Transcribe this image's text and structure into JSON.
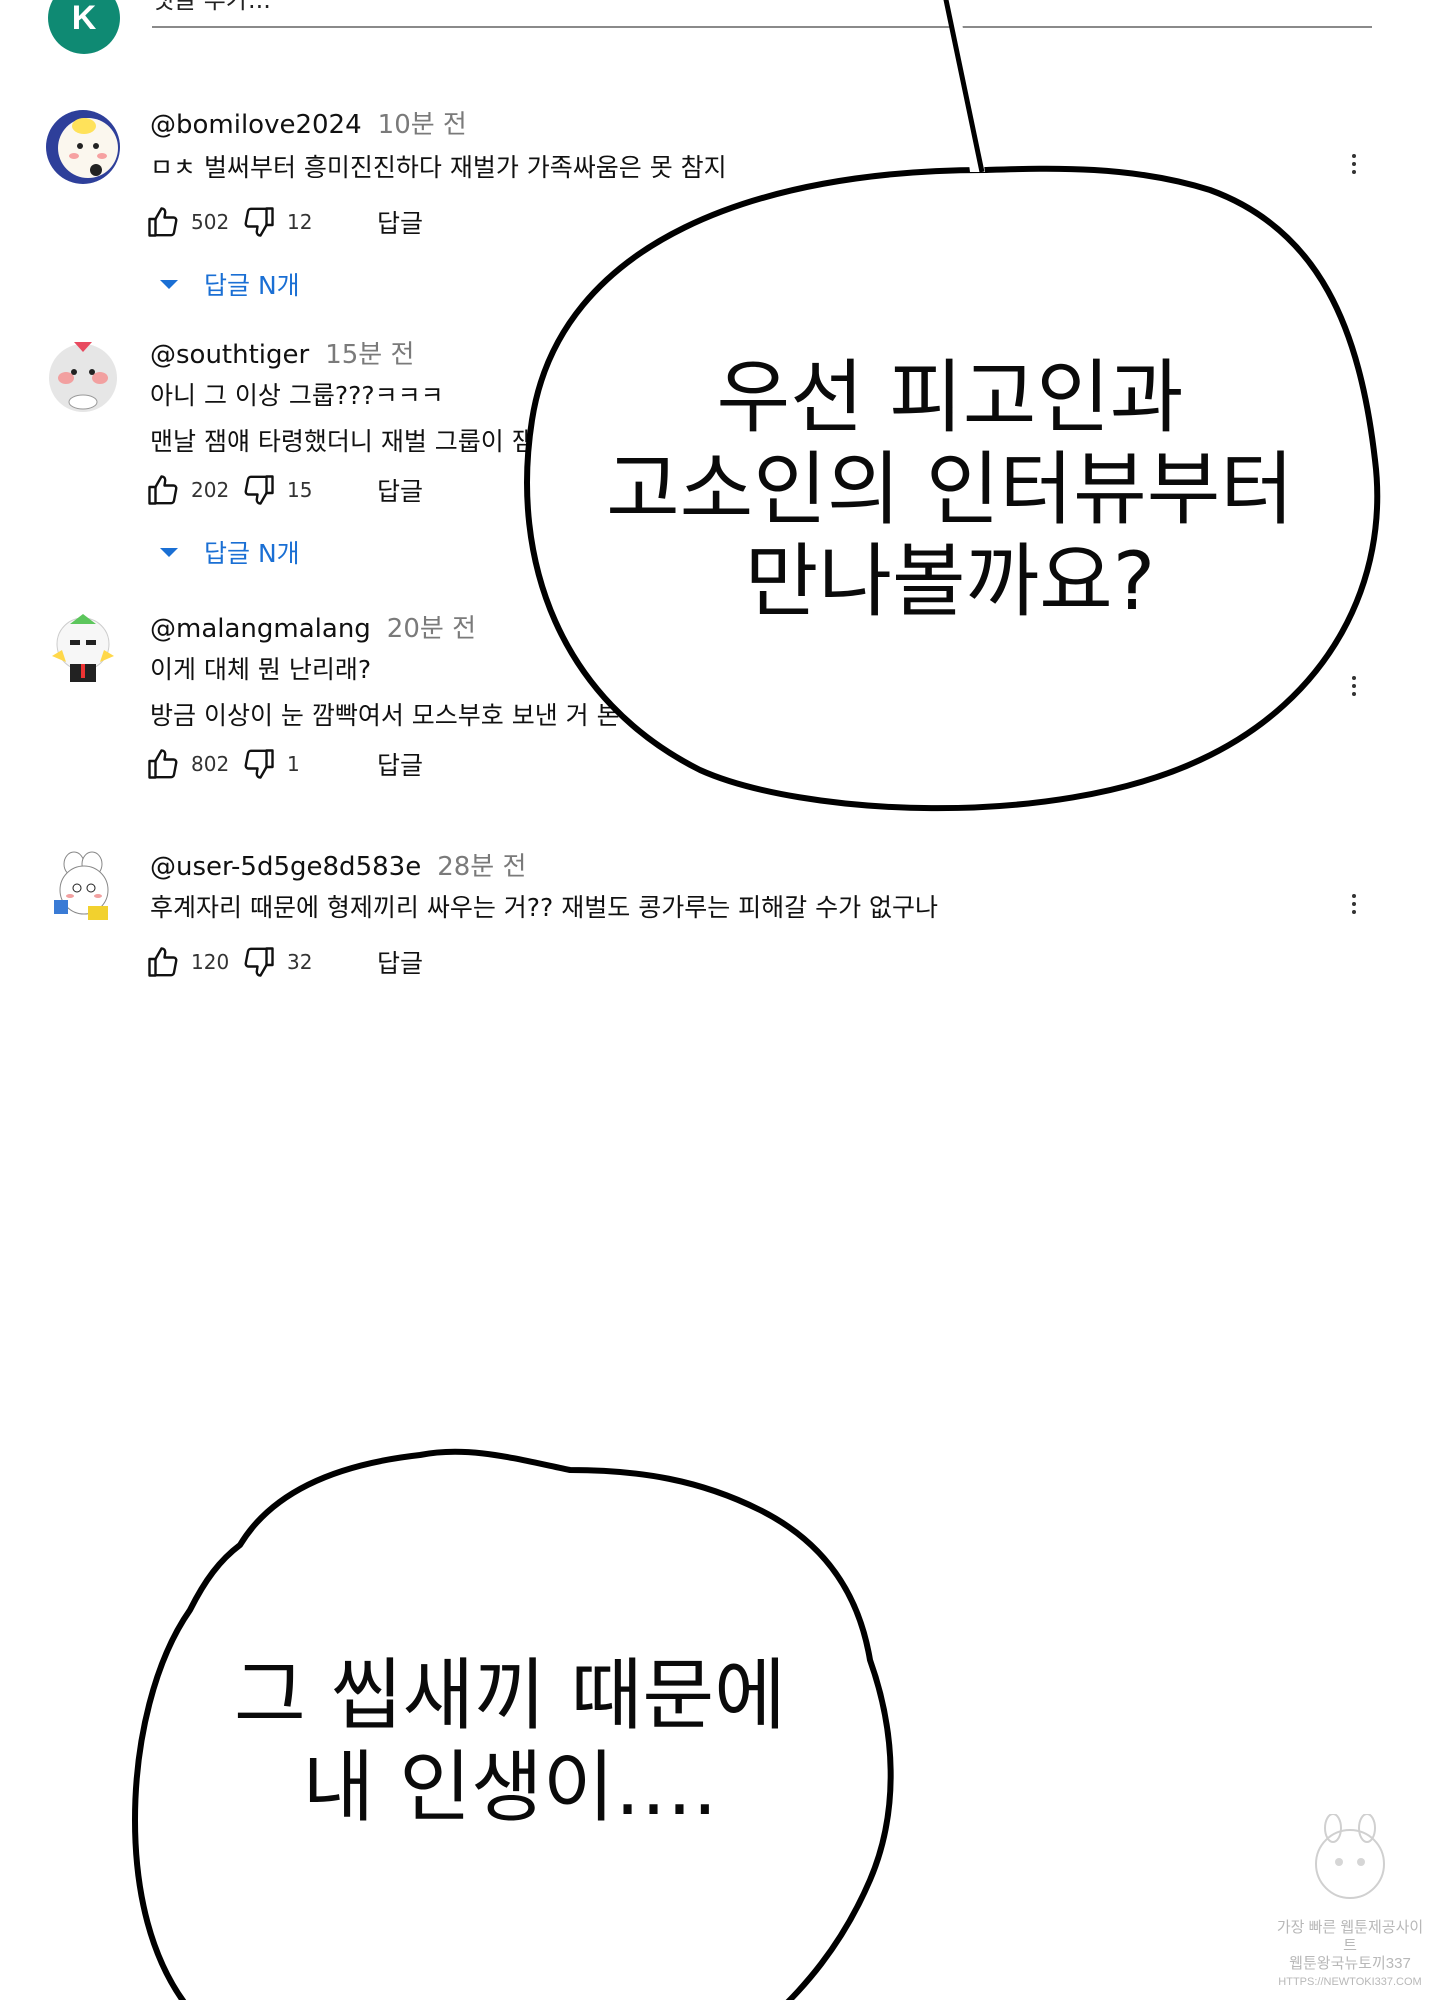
{
  "composer": {
    "avatar_letter": "K",
    "placeholder": "댓글 추가..."
  },
  "comments": [
    {
      "handle": "@bomilove2024",
      "time": "10분 전",
      "lines": [
        "ㅁㅊ 벌써부터 흥미진진하다 재벌가 가족싸움은 못 참지"
      ],
      "likes": "502",
      "dislikes": "12",
      "reply_label": "답글",
      "replies_label": "답글 N개"
    },
    {
      "handle": "@southtiger",
      "time": "15분 전",
      "lines": [
        "아니 그 이상 그룹???ㅋㅋㅋ",
        "맨날 잼얘 타령했더니 재벌 그룹이 잼얘 떠먹여주네 ㄷㄷ"
      ],
      "likes": "202",
      "dislikes": "15",
      "reply_label": "답글",
      "replies_label": "답글 N개"
    },
    {
      "handle": "@malangmalang",
      "time": "20분 전",
      "lines": [
        "이게 대체 뭔 난리래?",
        "방금 이상이 눈 깜빡여서 모스부호 보낸 거 본 사람?"
      ],
      "likes": "802",
      "dislikes": "1",
      "reply_label": "답글"
    },
    {
      "handle": "@user-5d5ge8d583e",
      "time": "28분 전",
      "lines": [
        "후계자리 때문에 형제끼리 싸우는 거?? 재벌도 콩가루는 피해갈 수가 없구나"
      ],
      "likes": "120",
      "dislikes": "32",
      "reply_label": "답글"
    }
  ],
  "bubbles": [
    {
      "lines": [
        "우선 피고인과",
        "고소인의 인터뷰부터",
        "만나볼까요?"
      ]
    },
    {
      "lines": [
        "그 씹새끼 때문에",
        "내 인생이…."
      ]
    }
  ],
  "watermark": {
    "lines": [
      "가장 빠른 웹툰제공사이트",
      "웹툰왕국뉴토끼337",
      "HTTPS://NEWTOKI337.COM"
    ]
  },
  "colors": {
    "composer_avatar": "#0f8a73",
    "link_blue": "#1a6fd4",
    "timestamp_gray": "#7a7a7a"
  }
}
